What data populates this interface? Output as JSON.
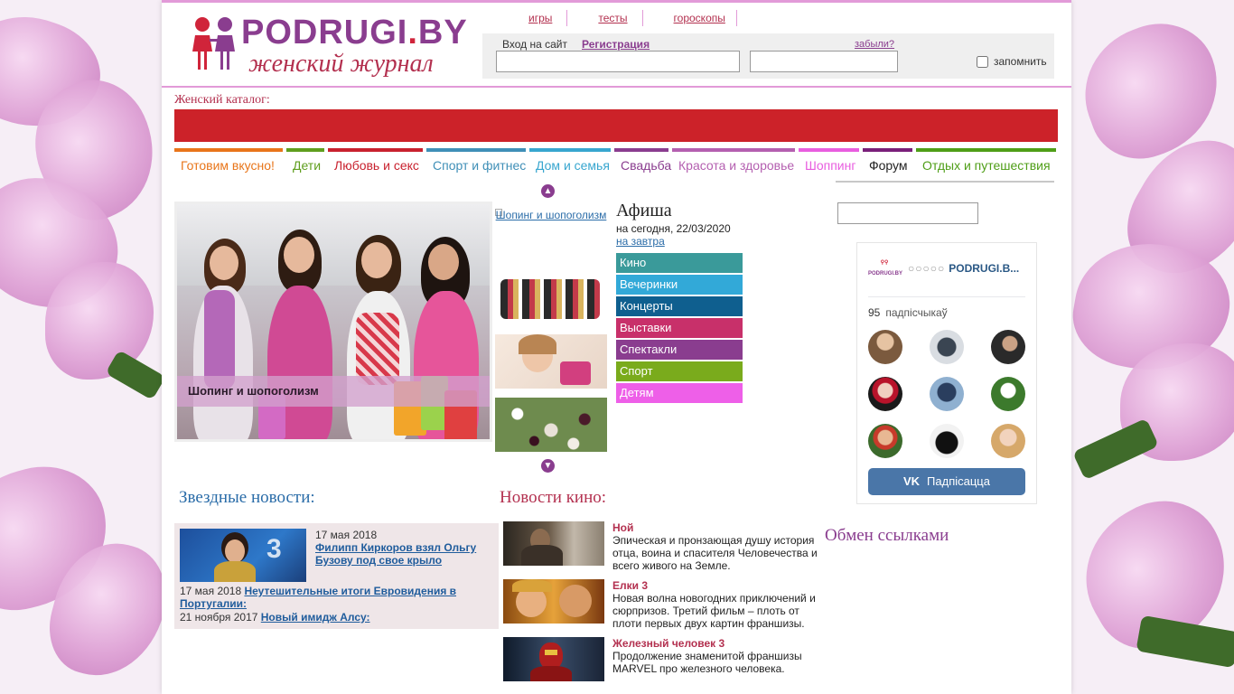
{
  "header": {
    "brand_main": "PODRUGI",
    "brand_dot": ".",
    "brand_tld": "BY",
    "tagline": "женский журнал",
    "top_nav": [
      "игры",
      "тесты",
      "гороскопы"
    ]
  },
  "login": {
    "label": "Вход на сайт",
    "register": "Регистрация",
    "forgot": "забыли?",
    "remember": "запомнить",
    "username_value": "",
    "password_value": ""
  },
  "catalog": {
    "label": "Женский каталог:"
  },
  "categories": [
    {
      "label": "Готовим вкусно!",
      "color": "#e8751a"
    },
    {
      "label": "Дети",
      "color": "#5f9e1e"
    },
    {
      "label": "Любовь и секс",
      "color": "#c8212e"
    },
    {
      "label": "Спорт и фитнес",
      "color": "#3f8fb7"
    },
    {
      "label": "Дом и семья",
      "color": "#38a6cf"
    },
    {
      "label": "Свадьба",
      "color": "#8a3d8f"
    },
    {
      "label": "Красота и здоровье",
      "color": "#b45fb0"
    },
    {
      "label": "Шоппинг",
      "color": "#e85ddf"
    },
    {
      "label": "Форум",
      "color": "#7a1f7a"
    },
    {
      "label": "Отдых и путешествия",
      "color": "#4f9e17"
    }
  ],
  "slider": {
    "caption": "Шопинг и шопоголизм",
    "thumb_link": "Шопинг и шопоголизм"
  },
  "afisha": {
    "title": "Афиша",
    "today": "на сегодня, 22/03/2020",
    "tomorrow": "на завтра",
    "items": [
      {
        "label": "Кино",
        "color": "#3a9a9a"
      },
      {
        "label": "Вечеринки",
        "color": "#32a9d8"
      },
      {
        "label": "Концерты",
        "color": "#0f5f8f"
      },
      {
        "label": "Выставки",
        "color": "#c8306a"
      },
      {
        "label": "Спектакли",
        "color": "#8a3d8f"
      },
      {
        "label": "Спорт",
        "color": "#7aab1c"
      },
      {
        "label": "Детям",
        "color": "#ee5fe8"
      }
    ]
  },
  "vk": {
    "logo": "PODRUGI.BY",
    "pins": "○○○○○",
    "title": "PODRUGI.B...",
    "count": "95",
    "count_label": "падпісчыкаў",
    "button_icon": "VK",
    "button": "Падпісацца"
  },
  "sections": {
    "star": "Звездные новости:",
    "kino": "Новости кино:",
    "obmen": "Обмен ссылками"
  },
  "star_news": [
    {
      "date": "17 мая 2018",
      "title": "Филипп Киркоров взял Ольгу Бузову под свое крыло"
    },
    {
      "date": "17 мая 2018",
      "title": "Неутешительные итоги Евровидения в Португалии:"
    },
    {
      "date": "21 ноября 2017",
      "title": "Новый имидж Алсу:"
    }
  ],
  "kino_news": [
    {
      "title": "Ной",
      "text": "Эпическая и пронзающая душу история отца, воина и спасителя Человечества и всего живого на Земле."
    },
    {
      "title": "Елки 3",
      "text": "Новая волна новогодних приключений и сюрпризов. Третий фильм – плоть от плоти первых двух картин франшизы."
    },
    {
      "title": "Железный человек 3",
      "text": "Продолжение знаменитой франшизы MARVEL про железного человека."
    }
  ],
  "icons": {
    "arrow_up": "chevron-up-icon",
    "arrow_down": "chevron-down-icon",
    "vk": "vk-icon"
  }
}
